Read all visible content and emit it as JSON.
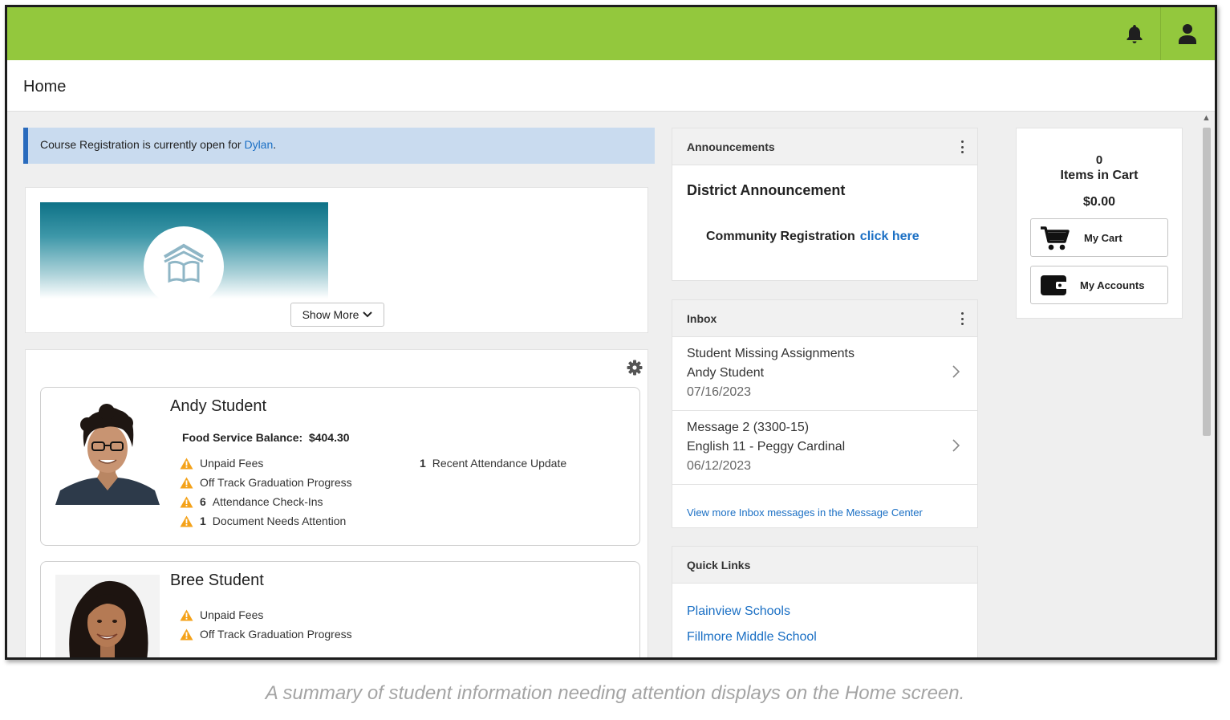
{
  "header": {
    "bell_icon": "bell-icon",
    "user_icon": "user-icon",
    "bar_color": "#93c83d"
  },
  "page": {
    "title": "Home"
  },
  "registration_banner": {
    "text": "Course Registration is currently open for ",
    "student_link": "Dylan",
    "trailing": "."
  },
  "hero": {
    "show_more_label": "Show More",
    "icon": "book-house-icon"
  },
  "students": [
    {
      "name": "Andy Student",
      "food_label": "Food Service Balance:",
      "food_value": "$404.30",
      "alerts": [
        {
          "count": "",
          "text": "Unpaid Fees"
        },
        {
          "count": "",
          "text": "Off Track Graduation Progress"
        },
        {
          "count": "6",
          "text": "Attendance Check-Ins"
        },
        {
          "count": "1",
          "text": "Document Needs Attention"
        }
      ],
      "updates": [
        {
          "count": "1",
          "text": "Recent Attendance Update"
        }
      ]
    },
    {
      "name": "Bree Student",
      "alerts": [
        {
          "count": "",
          "text": "Unpaid Fees"
        },
        {
          "count": "",
          "text": "Off Track Graduation Progress"
        }
      ]
    }
  ],
  "announcements": {
    "header": "Announcements",
    "title": "District Announcement",
    "community_text": "Community Registration",
    "community_link": "click here"
  },
  "inbox": {
    "header": "Inbox",
    "messages": [
      {
        "subject": "Student Missing Assignments",
        "detail": "Andy Student",
        "date": "07/16/2023"
      },
      {
        "subject": "Message 2 (3300-15)",
        "detail": "English 11 - Peggy Cardinal",
        "date": "06/12/2023"
      }
    ],
    "view_more": "View more Inbox messages in the Message Center"
  },
  "quick_links": {
    "header": "Quick Links",
    "links": [
      "Plainview Schools",
      "Fillmore Middle School"
    ]
  },
  "cart": {
    "count": "0",
    "items_label": "Items in Cart",
    "total": "$0.00",
    "my_cart_label": "My Cart",
    "my_accounts_label": "My Accounts"
  },
  "caption": "A summary of student information needing attention displays on the Home screen."
}
